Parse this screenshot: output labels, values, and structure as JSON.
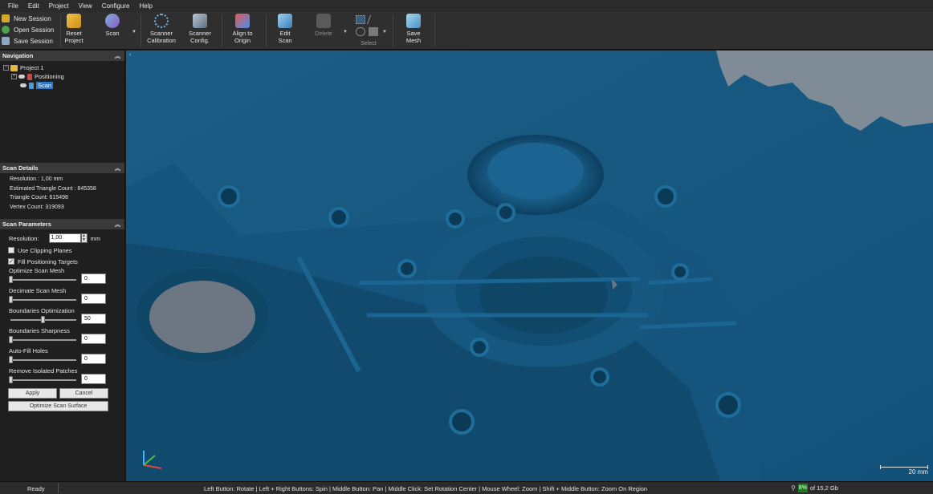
{
  "menu": [
    "File",
    "Edit",
    "Project",
    "View",
    "Configure",
    "Help"
  ],
  "session": {
    "new": "New Session",
    "open": "Open Session",
    "save": "Save Session"
  },
  "toolbar": {
    "reset": [
      "Reset",
      "Project"
    ],
    "scan": "Scan",
    "scanner_calibration": [
      "Scanner",
      "Calibration"
    ],
    "scanner_config": [
      "Scanner",
      "Config."
    ],
    "align": [
      "Align to",
      "Origin"
    ],
    "edit_scan": [
      "Edit",
      "Scan"
    ],
    "delete": "Delete",
    "select_label": "Select",
    "save_mesh": [
      "Save",
      "Mesh"
    ]
  },
  "navigation": {
    "title": "Navigation",
    "project": "Project 1",
    "positioning": "Positioning",
    "scan": "Scan"
  },
  "scan_details": {
    "title": "Scan Details",
    "resolution": "Resolution : 1,00 mm",
    "estimated": "Estimated Triangle Count : 845358",
    "triangles": "Triangle Count: 615498",
    "vertices": "Vertex Count: 319093"
  },
  "scan_parameters": {
    "title": "Scan Parameters",
    "resolution_label": "Resolution:",
    "resolution_value": "1,00",
    "resolution_unit": "mm",
    "use_clipping": "Use Clipping Planes",
    "use_clipping_checked": false,
    "fill_targets": "Fill Positioning Targets",
    "fill_targets_checked": true,
    "sliders": [
      {
        "label": "Optimize Scan Mesh",
        "value": "0",
        "level": 0
      },
      {
        "label": "Decimate Scan Mesh",
        "value": "0",
        "level": 0
      },
      {
        "label": "Boundaries Optimization",
        "value": "50",
        "level": 0.5
      },
      {
        "label": "Boundaries Sharpness",
        "value": "0",
        "level": 0
      },
      {
        "label": "Auto-Fill Holes",
        "value": "0",
        "level": 0
      },
      {
        "label": "Remove Isolated Patches",
        "value": "0",
        "level": 0
      }
    ],
    "apply": "Apply",
    "cancel": "Cancel",
    "optimize": "Optimize Scan Surface"
  },
  "viewport": {
    "scale": "20 mm",
    "mesh_color": "#13557c"
  },
  "status": {
    "ready": "Ready",
    "hint": "Left Button: Rotate  |  Left + Right Buttons: Spin  |  Middle Button: Pan  |  Middle Click: Set Rotation Center  |  Mouse Wheel: Zoom  |  Shift + Middle Button: Zoom On Region",
    "mem_percent": "8%",
    "mem_total": "of 15,2 Gb"
  }
}
